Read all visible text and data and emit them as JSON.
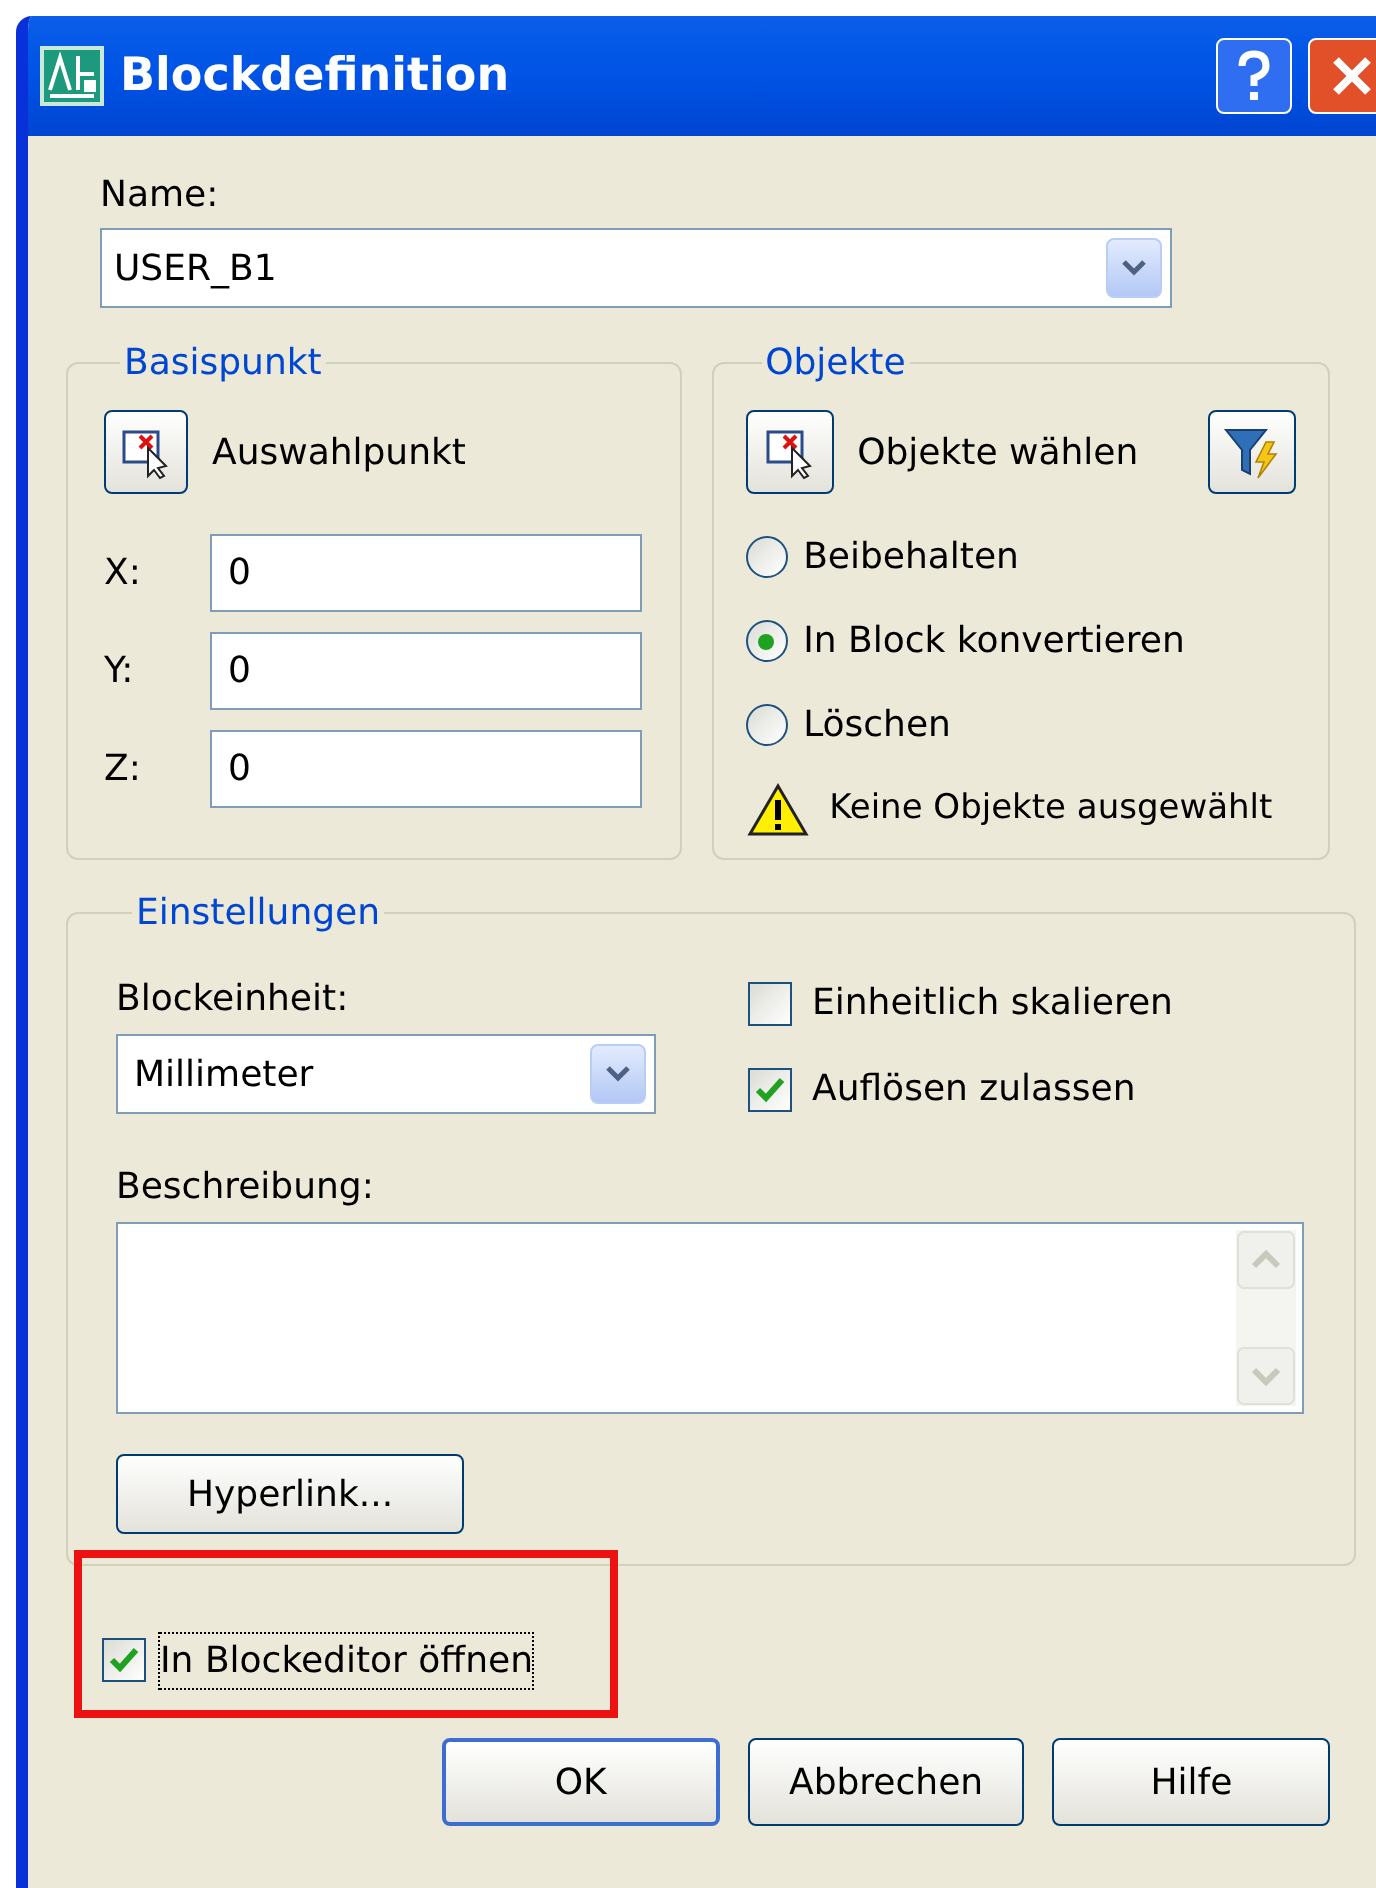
{
  "window": {
    "title": "Blockdefinition"
  },
  "name": {
    "label": "Name:",
    "value": "USER_B1"
  },
  "base_point": {
    "title": "Basispunkt",
    "pick_label": "Auswahlpunkt",
    "coords": [
      {
        "label": "X:",
        "value": "0"
      },
      {
        "label": "Y:",
        "value": "0"
      },
      {
        "label": "Z:",
        "value": "0"
      }
    ]
  },
  "objects": {
    "title": "Objekte",
    "select_label": "Objekte wählen",
    "options": [
      {
        "label": "Beibehalten",
        "selected": false
      },
      {
        "label": "In Block konvertieren",
        "selected": true
      },
      {
        "label": "Löschen",
        "selected": false
      }
    ],
    "warning": "Keine Objekte ausgewählt"
  },
  "settings": {
    "title": "Einstellungen",
    "unit_label": "Blockeinheit:",
    "unit_value": "Millimeter",
    "checkboxes": [
      {
        "label": "Einheitlich skalieren",
        "checked": false
      },
      {
        "label": "Auflösen zulassen",
        "checked": true
      }
    ],
    "description_label": "Beschreibung:",
    "hyperlink_button": "Hyperlink..."
  },
  "open_in_editor": {
    "label": "In Blockeditor öffnen",
    "checked": true,
    "highlighted": true
  },
  "buttons": [
    {
      "label": "OK",
      "default": true
    },
    {
      "label": "Abbrechen",
      "default": false
    },
    {
      "label": "Hilfe",
      "default": false
    }
  ]
}
